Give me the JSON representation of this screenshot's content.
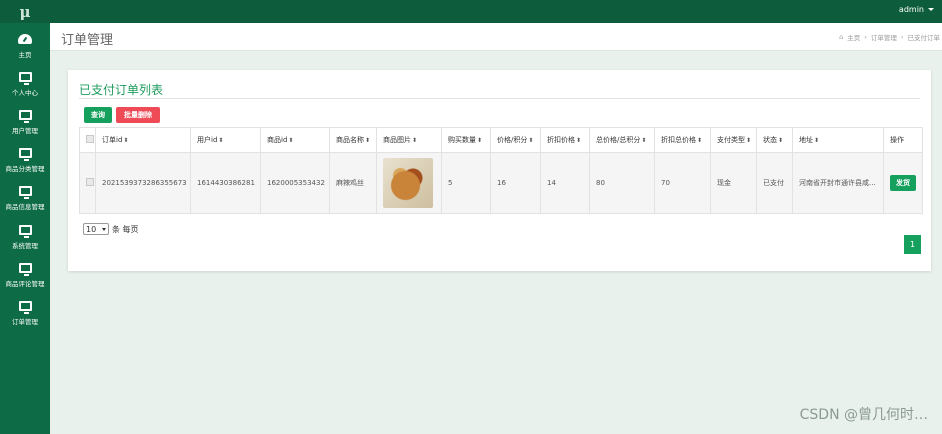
{
  "app": {
    "logo": "μ",
    "user": "admin"
  },
  "sidebar": {
    "items": [
      {
        "label": "主页",
        "icon": "dashboard-icon"
      },
      {
        "label": "个人中心",
        "icon": "monitor-icon"
      },
      {
        "label": "用户管理",
        "icon": "monitor-icon"
      },
      {
        "label": "商品分类管理",
        "icon": "monitor-icon"
      },
      {
        "label": "商品信息管理",
        "icon": "monitor-icon"
      },
      {
        "label": "系统管理",
        "icon": "monitor-icon"
      },
      {
        "label": "商品评论管理",
        "icon": "monitor-icon"
      },
      {
        "label": "订单管理",
        "icon": "monitor-icon"
      }
    ]
  },
  "header": {
    "title": "订单管理",
    "breadcrumb": [
      "主页",
      "订单管理",
      "已支付订单"
    ]
  },
  "panel": {
    "title": "已支付订单列表",
    "query_label": "查询",
    "batch_delete_label": "批量删除"
  },
  "table": {
    "columns": [
      "订单id",
      "用户id",
      "商品id",
      "商品名称",
      "商品图片",
      "购买数量",
      "价格/积分",
      "折扣价格",
      "总价格/总积分",
      "折扣总价格",
      "支付类型",
      "状态",
      "地址",
      "操作"
    ],
    "rows": [
      {
        "order_id": "2021539373286355673",
        "user_id": "1614430386281",
        "product_id": "1620005353432",
        "product_name": "麻辣鸡丝",
        "quantity": "5",
        "price": "16",
        "discount_price": "14",
        "total": "80",
        "discount_total": "70",
        "pay_type": "现金",
        "status": "已支付",
        "address": "河南省开封市通许县咸...",
        "action": "发货"
      }
    ]
  },
  "pagination": {
    "page_size": "10",
    "page_size_suffix": "条 每页",
    "current_page": "1"
  },
  "watermark": "CSDN @曾几何时…",
  "colors": {
    "brand": "#0d6b46",
    "accent": "#16a05d",
    "danger": "#ee4b56"
  }
}
